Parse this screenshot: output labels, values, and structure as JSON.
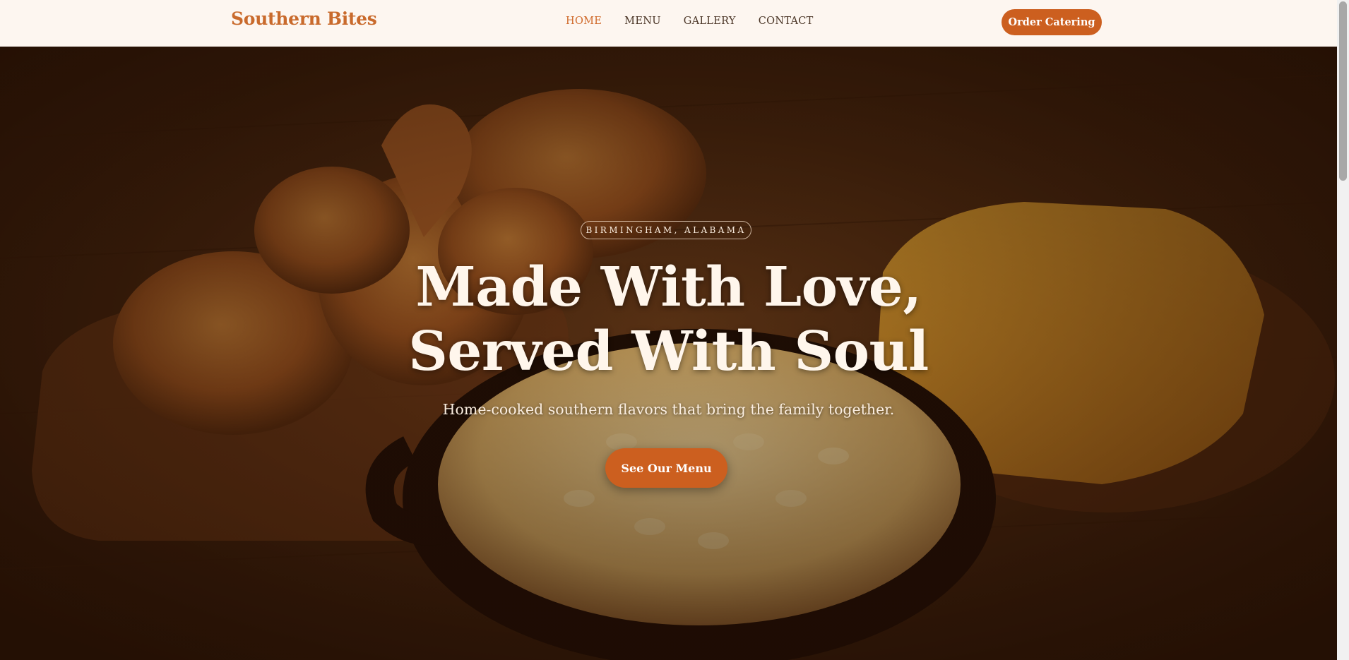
{
  "header": {
    "brand": "Southern Bites",
    "nav": [
      {
        "label": "HOME",
        "active": true
      },
      {
        "label": "MENU",
        "active": false
      },
      {
        "label": "GALLERY",
        "active": false
      },
      {
        "label": "CONTACT",
        "active": false
      }
    ],
    "cta_label": "Order Catering"
  },
  "hero": {
    "badge": "BIRMINGHAM, ALABAMA",
    "title_line1": "Made With Love,",
    "title_line2": "Served With Soul",
    "subtitle": "Home-cooked southern flavors that bring the family together.",
    "button_label": "See Our Menu",
    "background_image": "fried-chicken-mac-and-cheese-cornbread-photo"
  },
  "colors": {
    "accent": "#cc5f1f",
    "brand": "#c96a2c",
    "header_bg": "#fdf6f0",
    "nav_text": "#4a3526",
    "nav_active": "#d06a2b",
    "hero_text": "#fff6ec"
  }
}
